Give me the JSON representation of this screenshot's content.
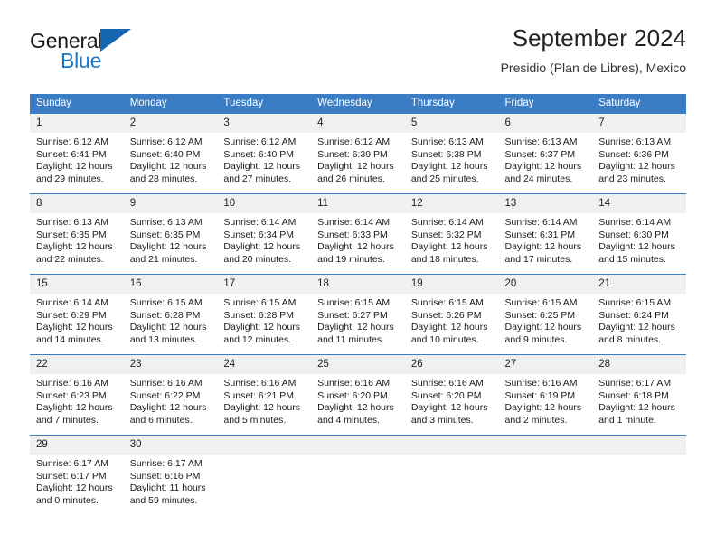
{
  "brand": {
    "name_part1": "General",
    "name_part2": "Blue",
    "logo_icon": "triangle-logo-icon"
  },
  "header": {
    "title": "September 2024",
    "subtitle": "Presidio (Plan de Libres), Mexico"
  },
  "colors": {
    "header_blue": "#3b7dc4",
    "daynum_gray": "#f0f0f0",
    "brand_blue": "#1878c8",
    "logo_blue": "#1565b0"
  },
  "weekdays": [
    "Sunday",
    "Monday",
    "Tuesday",
    "Wednesday",
    "Thursday",
    "Friday",
    "Saturday"
  ],
  "weeks": [
    [
      {
        "day": "1",
        "sunrise": "Sunrise: 6:12 AM",
        "sunset": "Sunset: 6:41 PM",
        "daylight": "Daylight: 12 hours and 29 minutes."
      },
      {
        "day": "2",
        "sunrise": "Sunrise: 6:12 AM",
        "sunset": "Sunset: 6:40 PM",
        "daylight": "Daylight: 12 hours and 28 minutes."
      },
      {
        "day": "3",
        "sunrise": "Sunrise: 6:12 AM",
        "sunset": "Sunset: 6:40 PM",
        "daylight": "Daylight: 12 hours and 27 minutes."
      },
      {
        "day": "4",
        "sunrise": "Sunrise: 6:12 AM",
        "sunset": "Sunset: 6:39 PM",
        "daylight": "Daylight: 12 hours and 26 minutes."
      },
      {
        "day": "5",
        "sunrise": "Sunrise: 6:13 AM",
        "sunset": "Sunset: 6:38 PM",
        "daylight": "Daylight: 12 hours and 25 minutes."
      },
      {
        "day": "6",
        "sunrise": "Sunrise: 6:13 AM",
        "sunset": "Sunset: 6:37 PM",
        "daylight": "Daylight: 12 hours and 24 minutes."
      },
      {
        "day": "7",
        "sunrise": "Sunrise: 6:13 AM",
        "sunset": "Sunset: 6:36 PM",
        "daylight": "Daylight: 12 hours and 23 minutes."
      }
    ],
    [
      {
        "day": "8",
        "sunrise": "Sunrise: 6:13 AM",
        "sunset": "Sunset: 6:35 PM",
        "daylight": "Daylight: 12 hours and 22 minutes."
      },
      {
        "day": "9",
        "sunrise": "Sunrise: 6:13 AM",
        "sunset": "Sunset: 6:35 PM",
        "daylight": "Daylight: 12 hours and 21 minutes."
      },
      {
        "day": "10",
        "sunrise": "Sunrise: 6:14 AM",
        "sunset": "Sunset: 6:34 PM",
        "daylight": "Daylight: 12 hours and 20 minutes."
      },
      {
        "day": "11",
        "sunrise": "Sunrise: 6:14 AM",
        "sunset": "Sunset: 6:33 PM",
        "daylight": "Daylight: 12 hours and 19 minutes."
      },
      {
        "day": "12",
        "sunrise": "Sunrise: 6:14 AM",
        "sunset": "Sunset: 6:32 PM",
        "daylight": "Daylight: 12 hours and 18 minutes."
      },
      {
        "day": "13",
        "sunrise": "Sunrise: 6:14 AM",
        "sunset": "Sunset: 6:31 PM",
        "daylight": "Daylight: 12 hours and 17 minutes."
      },
      {
        "day": "14",
        "sunrise": "Sunrise: 6:14 AM",
        "sunset": "Sunset: 6:30 PM",
        "daylight": "Daylight: 12 hours and 15 minutes."
      }
    ],
    [
      {
        "day": "15",
        "sunrise": "Sunrise: 6:14 AM",
        "sunset": "Sunset: 6:29 PM",
        "daylight": "Daylight: 12 hours and 14 minutes."
      },
      {
        "day": "16",
        "sunrise": "Sunrise: 6:15 AM",
        "sunset": "Sunset: 6:28 PM",
        "daylight": "Daylight: 12 hours and 13 minutes."
      },
      {
        "day": "17",
        "sunrise": "Sunrise: 6:15 AM",
        "sunset": "Sunset: 6:28 PM",
        "daylight": "Daylight: 12 hours and 12 minutes."
      },
      {
        "day": "18",
        "sunrise": "Sunrise: 6:15 AM",
        "sunset": "Sunset: 6:27 PM",
        "daylight": "Daylight: 12 hours and 11 minutes."
      },
      {
        "day": "19",
        "sunrise": "Sunrise: 6:15 AM",
        "sunset": "Sunset: 6:26 PM",
        "daylight": "Daylight: 12 hours and 10 minutes."
      },
      {
        "day": "20",
        "sunrise": "Sunrise: 6:15 AM",
        "sunset": "Sunset: 6:25 PM",
        "daylight": "Daylight: 12 hours and 9 minutes."
      },
      {
        "day": "21",
        "sunrise": "Sunrise: 6:15 AM",
        "sunset": "Sunset: 6:24 PM",
        "daylight": "Daylight: 12 hours and 8 minutes."
      }
    ],
    [
      {
        "day": "22",
        "sunrise": "Sunrise: 6:16 AM",
        "sunset": "Sunset: 6:23 PM",
        "daylight": "Daylight: 12 hours and 7 minutes."
      },
      {
        "day": "23",
        "sunrise": "Sunrise: 6:16 AM",
        "sunset": "Sunset: 6:22 PM",
        "daylight": "Daylight: 12 hours and 6 minutes."
      },
      {
        "day": "24",
        "sunrise": "Sunrise: 6:16 AM",
        "sunset": "Sunset: 6:21 PM",
        "daylight": "Daylight: 12 hours and 5 minutes."
      },
      {
        "day": "25",
        "sunrise": "Sunrise: 6:16 AM",
        "sunset": "Sunset: 6:20 PM",
        "daylight": "Daylight: 12 hours and 4 minutes."
      },
      {
        "day": "26",
        "sunrise": "Sunrise: 6:16 AM",
        "sunset": "Sunset: 6:20 PM",
        "daylight": "Daylight: 12 hours and 3 minutes."
      },
      {
        "day": "27",
        "sunrise": "Sunrise: 6:16 AM",
        "sunset": "Sunset: 6:19 PM",
        "daylight": "Daylight: 12 hours and 2 minutes."
      },
      {
        "day": "28",
        "sunrise": "Sunrise: 6:17 AM",
        "sunset": "Sunset: 6:18 PM",
        "daylight": "Daylight: 12 hours and 1 minute."
      }
    ],
    [
      {
        "day": "29",
        "sunrise": "Sunrise: 6:17 AM",
        "sunset": "Sunset: 6:17 PM",
        "daylight": "Daylight: 12 hours and 0 minutes."
      },
      {
        "day": "30",
        "sunrise": "Sunrise: 6:17 AM",
        "sunset": "Sunset: 6:16 PM",
        "daylight": "Daylight: 11 hours and 59 minutes."
      },
      {
        "day": "",
        "sunrise": "",
        "sunset": "",
        "daylight": ""
      },
      {
        "day": "",
        "sunrise": "",
        "sunset": "",
        "daylight": ""
      },
      {
        "day": "",
        "sunrise": "",
        "sunset": "",
        "daylight": ""
      },
      {
        "day": "",
        "sunrise": "",
        "sunset": "",
        "daylight": ""
      },
      {
        "day": "",
        "sunrise": "",
        "sunset": "",
        "daylight": ""
      }
    ]
  ]
}
